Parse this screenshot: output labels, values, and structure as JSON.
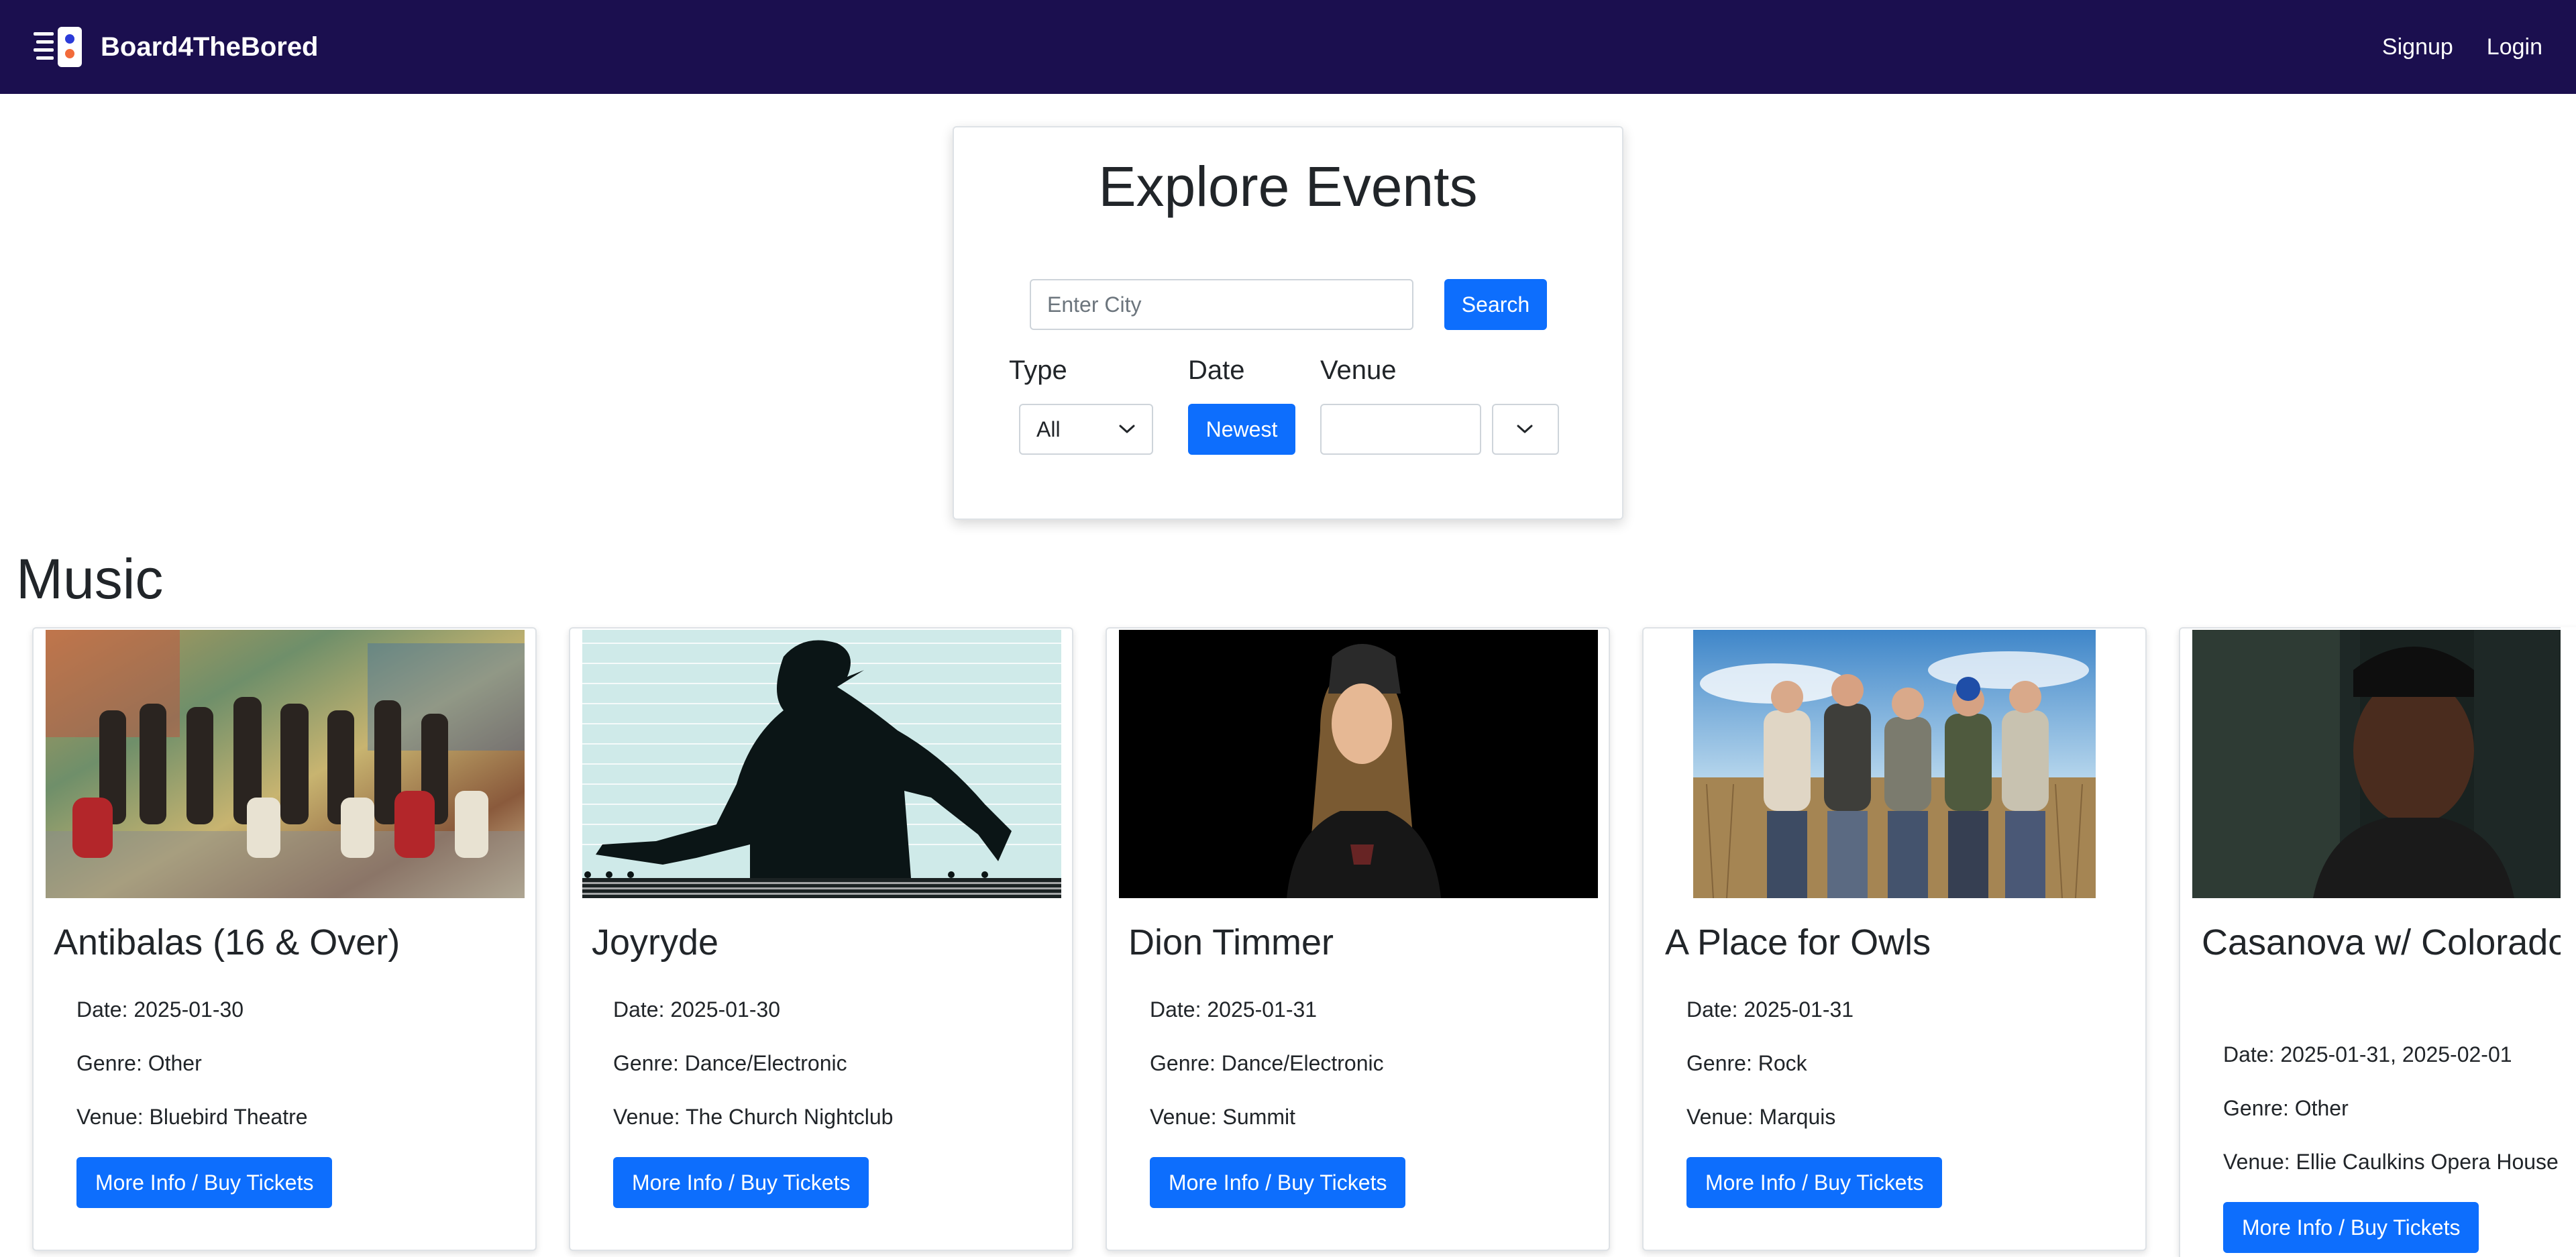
{
  "nav": {
    "brand": "Board4TheBored",
    "links": [
      "Signup",
      "Login"
    ]
  },
  "search": {
    "title": "Explore Events",
    "city_placeholder": "Enter City",
    "search_label": "Search",
    "type_label": "Type",
    "type_value": "All",
    "date_label": "Date",
    "date_button": "Newest",
    "venue_label": "Venue",
    "venue_value": ""
  },
  "section": {
    "title": "Music"
  },
  "events": [
    {
      "title": "Antibalas (16 & Over)",
      "date": "Date: 2025-01-30",
      "genre": "Genre: Other",
      "venue": "Venue: Bluebird Theatre",
      "button": "More Info / Buy Tickets"
    },
    {
      "title": "Joyryde",
      "date": "Date: 2025-01-30",
      "genre": "Genre: Dance/Electronic",
      "venue": "Venue: The Church Nightclub",
      "button": "More Info / Buy Tickets"
    },
    {
      "title": "Dion Timmer",
      "date": "Date: 2025-01-31",
      "genre": "Genre: Dance/Electronic",
      "venue": "Venue: Summit",
      "button": "More Info / Buy Tickets"
    },
    {
      "title": "A Place for Owls",
      "date": "Date: 2025-01-31",
      "genre": "Genre: Rock",
      "venue": "Venue: Marquis",
      "button": "More Info / Buy Tickets"
    },
    {
      "title": "Casanova w/ Colorado Ballet",
      "date": "Date: 2025-01-31, 2025-02-01",
      "genre": "Genre: Other",
      "venue": "Venue: Ellie Caulkins Opera House",
      "button": "More Info / Buy Tickets"
    }
  ],
  "colors": {
    "navbar": "#1b0f4f",
    "primary": "#0d6efd"
  }
}
